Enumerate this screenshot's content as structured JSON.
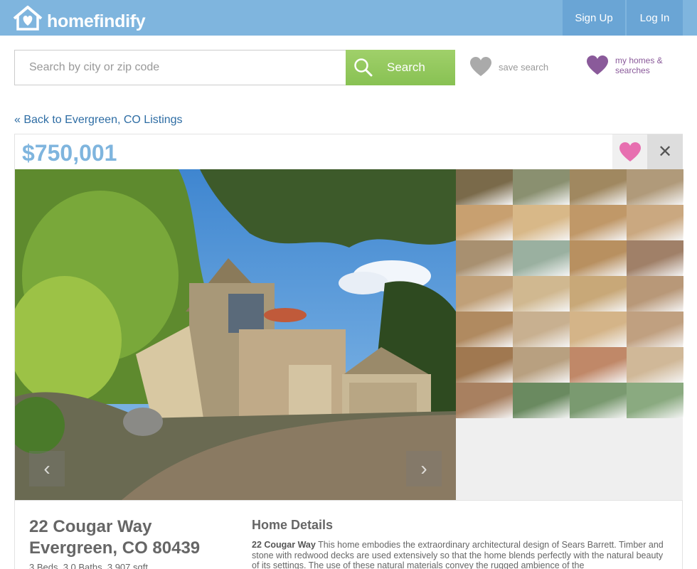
{
  "header": {
    "brand": "homefindify",
    "signup_label": "Sign Up",
    "login_label": "Log In",
    "colors": {
      "bar": "#7fb5de",
      "buttons": "#6aa5d5"
    }
  },
  "search": {
    "placeholder": "Search by city or zip code",
    "value": "",
    "button_label": "Search",
    "button_color": "#88c153"
  },
  "actions": {
    "save_search_label": "save search",
    "my_homes_label": "my homes & searches"
  },
  "back_link": "« Back to Evergreen, CO Listings",
  "listing": {
    "price": "$750,001",
    "address_line1": "22 Cougar Way",
    "address_line2": "Evergreen, CO 80439",
    "facts": "3 Beds, 3.0 Baths, 3,907 sqft",
    "details_title": "Home Details",
    "details_street": "22 Cougar Way",
    "details_text": "This home embodies the extraordinary architectural design of Sears Barrett. Timber and stone with redwood decks are used extensively so that the home blends perfectly with the natural beauty of its settings. The use of these natural materials convey the rugged ambience of the"
  },
  "gallery": {
    "thumbnail_count": 28,
    "thumb_tones": [
      "#7a6a4a",
      "#8a9070",
      "#a08860",
      "#b09a7a",
      "#c8a070",
      "#d8b888",
      "#c09868",
      "#caa880",
      "#a89070",
      "#9ab0a0",
      "#b89060",
      "#a08068",
      "#c0a078",
      "#d0b890",
      "#c8a878",
      "#b89878",
      "#b08a60",
      "#c8b090",
      "#d4b488",
      "#c0a080",
      "#a07850",
      "#b8a080",
      "#c08868",
      "#d0b898",
      "#a88060",
      "#6a8a60",
      "#7a9a70",
      "#8aaa80"
    ],
    "accent_heart": "#e76fb0",
    "my_homes_heart": "#8a5a9a",
    "save_heart": "#aaaaaa"
  }
}
